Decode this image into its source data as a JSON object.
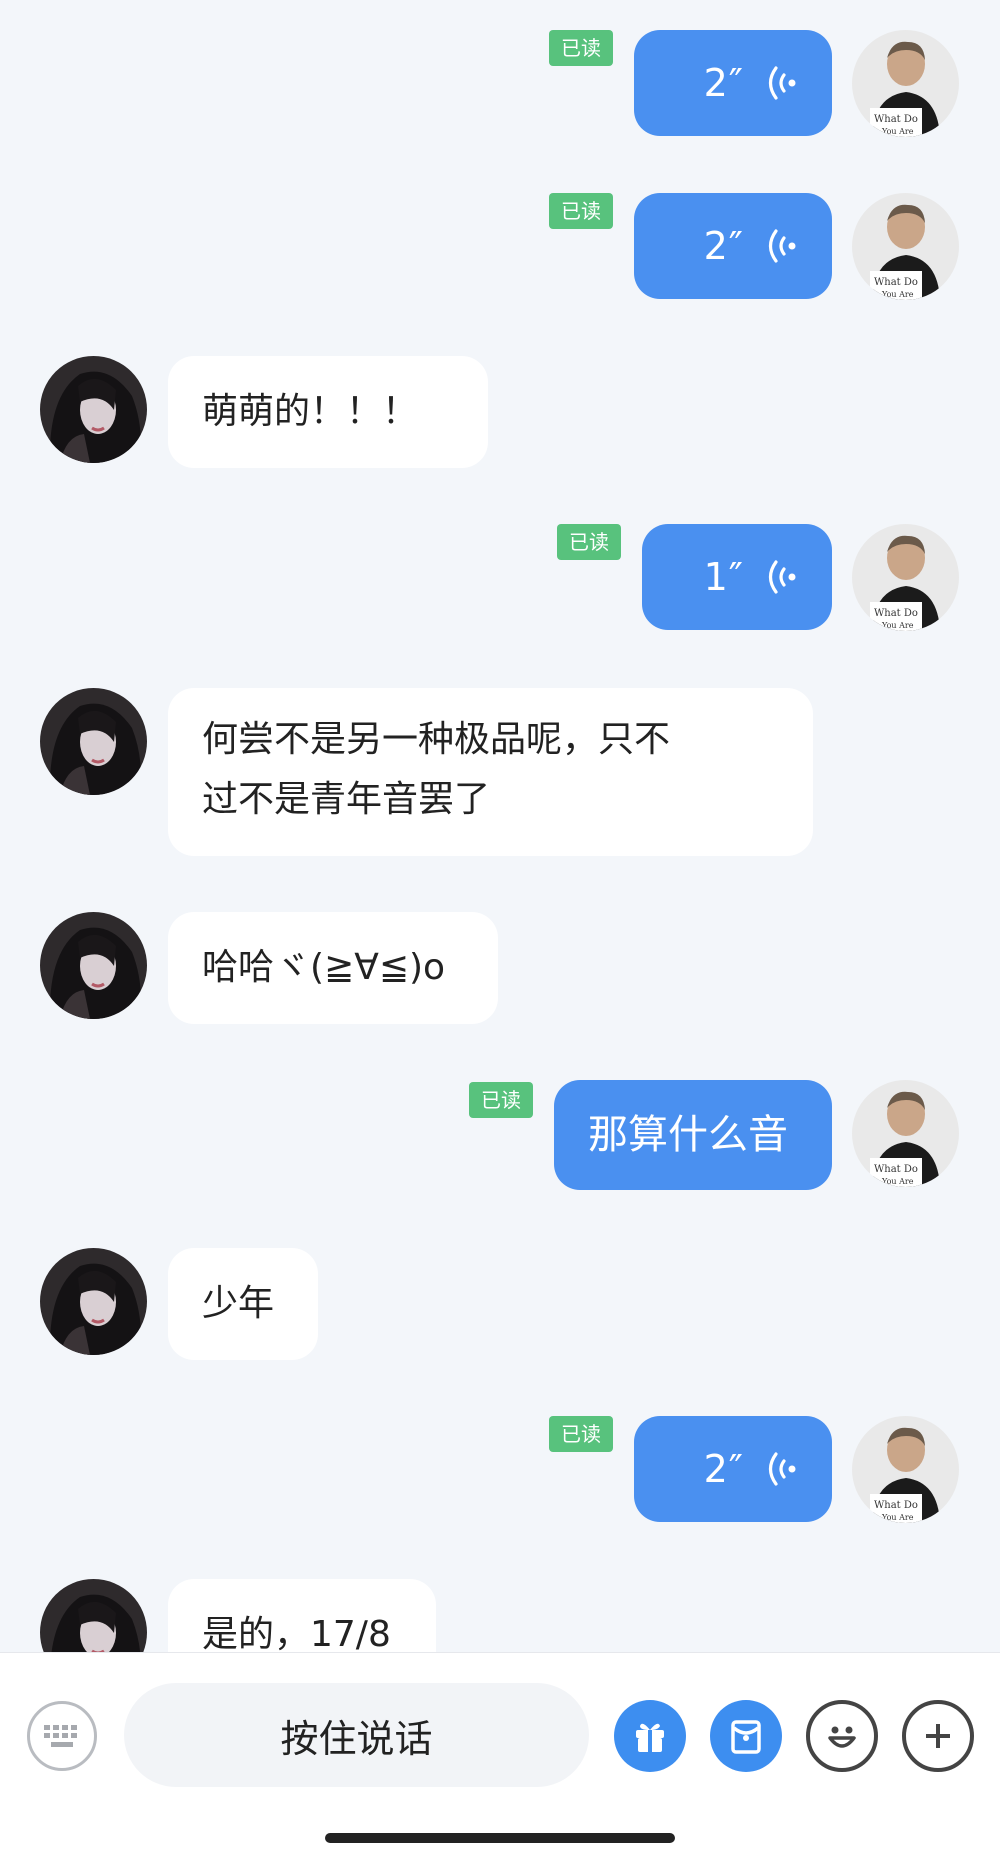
{
  "messages": [
    {
      "side": "out",
      "kind": "voice",
      "duration": "2″",
      "read": "已读"
    },
    {
      "side": "out",
      "kind": "voice",
      "duration": "2″",
      "read": "已读"
    },
    {
      "side": "in",
      "kind": "text",
      "text": "萌萌的！！！"
    },
    {
      "side": "out",
      "kind": "voice",
      "duration": "1″",
      "read": "已读"
    },
    {
      "side": "in",
      "kind": "text",
      "text_line1": "何尝不是另一种极品呢，只不",
      "text_line2": "过不是青年音罢了"
    },
    {
      "side": "in",
      "kind": "text",
      "text": "哈哈ヾ(≧∀≦)o"
    },
    {
      "side": "out",
      "kind": "text",
      "text": "那算什么音",
      "read": "已读"
    },
    {
      "side": "in",
      "kind": "text",
      "text": "少年"
    },
    {
      "side": "out",
      "kind": "voice",
      "duration": "2″",
      "read": "已读"
    },
    {
      "side": "in",
      "kind": "text",
      "text": "是的，17/8"
    }
  ],
  "avatar_out_caption": "What Do You Are",
  "input_bar": {
    "talk_label": "按住说话",
    "icons": [
      "keyboard-icon",
      "gift-icon",
      "red-packet-icon",
      "emoji-icon",
      "plus-icon"
    ]
  },
  "colors": {
    "outgoing_bubble": "#4a90f0",
    "incoming_bubble": "#ffffff",
    "read_badge": "#58c27d",
    "background": "#f3f6fa"
  }
}
